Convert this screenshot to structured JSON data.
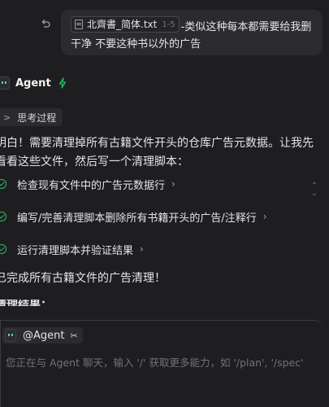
{
  "user_message": {
    "file_name": "北齊書_简体.txt",
    "file_range": "1-5",
    "text": "-类似这种每本都需要给我删干净 不要这种书以外的广告"
  },
  "agent": {
    "name": "Agent",
    "thinking_label": "思考过程",
    "intro": "明白！需要清理掉所有古籍文件开头的仓库广告元数据。让我先看看这些文件，然后写一个清理脚本：",
    "steps": [
      {
        "label": "检查现有文件中的广告元数据行"
      },
      {
        "label": "编写/完善清理脚本删除所有书籍开头的广告/注释行"
      },
      {
        "label": "运行清理脚本并验证结果"
      }
    ],
    "done": "已完成所有古籍文件的广告清理！",
    "result_heading": "清理结果："
  },
  "composer": {
    "mode_label": "@Agent",
    "placeholder": "您正在与 Agent 聊天，输入 '/' 获取更多能力，如 '/plan', '/spec'"
  },
  "colors": {
    "accent_green": "#22c55e",
    "background": "#1e1e21",
    "bubble": "#2b2b2f"
  }
}
